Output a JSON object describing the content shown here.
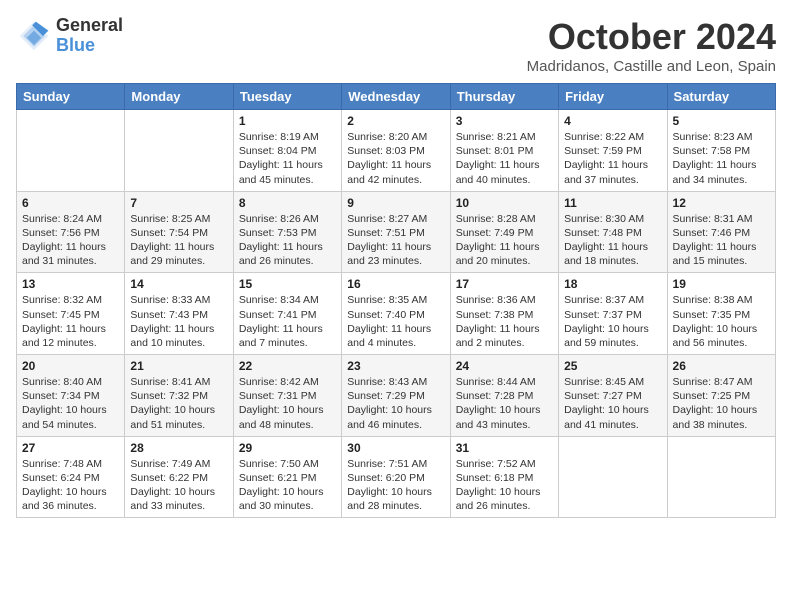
{
  "header": {
    "logo_general": "General",
    "logo_blue": "Blue",
    "month_title": "October 2024",
    "location": "Madridanos, Castille and Leon, Spain"
  },
  "days_of_week": [
    "Sunday",
    "Monday",
    "Tuesday",
    "Wednesday",
    "Thursday",
    "Friday",
    "Saturday"
  ],
  "weeks": [
    [
      {
        "day": "",
        "info": ""
      },
      {
        "day": "",
        "info": ""
      },
      {
        "day": "1",
        "info": "Sunrise: 8:19 AM\nSunset: 8:04 PM\nDaylight: 11 hours and 45 minutes."
      },
      {
        "day": "2",
        "info": "Sunrise: 8:20 AM\nSunset: 8:03 PM\nDaylight: 11 hours and 42 minutes."
      },
      {
        "day": "3",
        "info": "Sunrise: 8:21 AM\nSunset: 8:01 PM\nDaylight: 11 hours and 40 minutes."
      },
      {
        "day": "4",
        "info": "Sunrise: 8:22 AM\nSunset: 7:59 PM\nDaylight: 11 hours and 37 minutes."
      },
      {
        "day": "5",
        "info": "Sunrise: 8:23 AM\nSunset: 7:58 PM\nDaylight: 11 hours and 34 minutes."
      }
    ],
    [
      {
        "day": "6",
        "info": "Sunrise: 8:24 AM\nSunset: 7:56 PM\nDaylight: 11 hours and 31 minutes."
      },
      {
        "day": "7",
        "info": "Sunrise: 8:25 AM\nSunset: 7:54 PM\nDaylight: 11 hours and 29 minutes."
      },
      {
        "day": "8",
        "info": "Sunrise: 8:26 AM\nSunset: 7:53 PM\nDaylight: 11 hours and 26 minutes."
      },
      {
        "day": "9",
        "info": "Sunrise: 8:27 AM\nSunset: 7:51 PM\nDaylight: 11 hours and 23 minutes."
      },
      {
        "day": "10",
        "info": "Sunrise: 8:28 AM\nSunset: 7:49 PM\nDaylight: 11 hours and 20 minutes."
      },
      {
        "day": "11",
        "info": "Sunrise: 8:30 AM\nSunset: 7:48 PM\nDaylight: 11 hours and 18 minutes."
      },
      {
        "day": "12",
        "info": "Sunrise: 8:31 AM\nSunset: 7:46 PM\nDaylight: 11 hours and 15 minutes."
      }
    ],
    [
      {
        "day": "13",
        "info": "Sunrise: 8:32 AM\nSunset: 7:45 PM\nDaylight: 11 hours and 12 minutes."
      },
      {
        "day": "14",
        "info": "Sunrise: 8:33 AM\nSunset: 7:43 PM\nDaylight: 11 hours and 10 minutes."
      },
      {
        "day": "15",
        "info": "Sunrise: 8:34 AM\nSunset: 7:41 PM\nDaylight: 11 hours and 7 minutes."
      },
      {
        "day": "16",
        "info": "Sunrise: 8:35 AM\nSunset: 7:40 PM\nDaylight: 11 hours and 4 minutes."
      },
      {
        "day": "17",
        "info": "Sunrise: 8:36 AM\nSunset: 7:38 PM\nDaylight: 11 hours and 2 minutes."
      },
      {
        "day": "18",
        "info": "Sunrise: 8:37 AM\nSunset: 7:37 PM\nDaylight: 10 hours and 59 minutes."
      },
      {
        "day": "19",
        "info": "Sunrise: 8:38 AM\nSunset: 7:35 PM\nDaylight: 10 hours and 56 minutes."
      }
    ],
    [
      {
        "day": "20",
        "info": "Sunrise: 8:40 AM\nSunset: 7:34 PM\nDaylight: 10 hours and 54 minutes."
      },
      {
        "day": "21",
        "info": "Sunrise: 8:41 AM\nSunset: 7:32 PM\nDaylight: 10 hours and 51 minutes."
      },
      {
        "day": "22",
        "info": "Sunrise: 8:42 AM\nSunset: 7:31 PM\nDaylight: 10 hours and 48 minutes."
      },
      {
        "day": "23",
        "info": "Sunrise: 8:43 AM\nSunset: 7:29 PM\nDaylight: 10 hours and 46 minutes."
      },
      {
        "day": "24",
        "info": "Sunrise: 8:44 AM\nSunset: 7:28 PM\nDaylight: 10 hours and 43 minutes."
      },
      {
        "day": "25",
        "info": "Sunrise: 8:45 AM\nSunset: 7:27 PM\nDaylight: 10 hours and 41 minutes."
      },
      {
        "day": "26",
        "info": "Sunrise: 8:47 AM\nSunset: 7:25 PM\nDaylight: 10 hours and 38 minutes."
      }
    ],
    [
      {
        "day": "27",
        "info": "Sunrise: 7:48 AM\nSunset: 6:24 PM\nDaylight: 10 hours and 36 minutes."
      },
      {
        "day": "28",
        "info": "Sunrise: 7:49 AM\nSunset: 6:22 PM\nDaylight: 10 hours and 33 minutes."
      },
      {
        "day": "29",
        "info": "Sunrise: 7:50 AM\nSunset: 6:21 PM\nDaylight: 10 hours and 30 minutes."
      },
      {
        "day": "30",
        "info": "Sunrise: 7:51 AM\nSunset: 6:20 PM\nDaylight: 10 hours and 28 minutes."
      },
      {
        "day": "31",
        "info": "Sunrise: 7:52 AM\nSunset: 6:18 PM\nDaylight: 10 hours and 26 minutes."
      },
      {
        "day": "",
        "info": ""
      },
      {
        "day": "",
        "info": ""
      }
    ]
  ]
}
